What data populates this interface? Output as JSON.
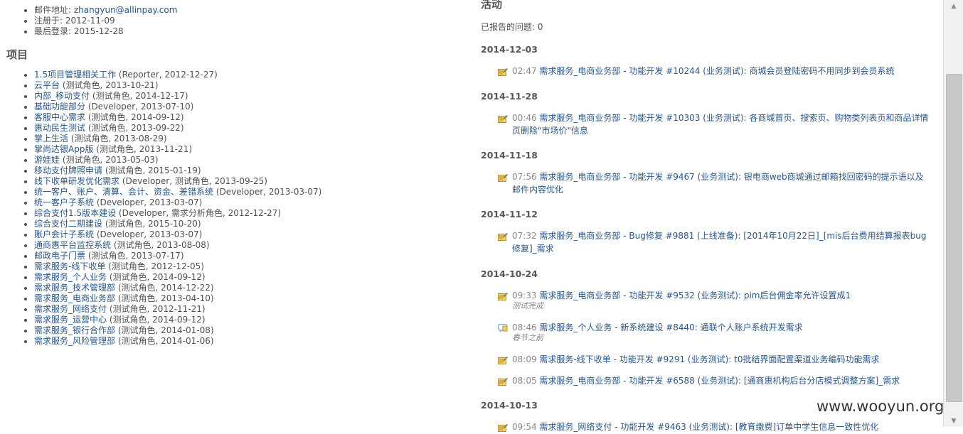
{
  "user_info": {
    "email_label": "邮件地址:",
    "email": "zhangyun@allinpay.com",
    "registered_label": "注册于:",
    "registered": "2012-11-09",
    "last_login_label": "最后登录:",
    "last_login": "2015-12-28"
  },
  "projects": {
    "title": "项目",
    "items": [
      {
        "name": "1.5项目管理相关工作",
        "meta": "(Reporter, 2012-12-27)"
      },
      {
        "name": "云平台",
        "meta": "(测试角色, 2013-10-21)"
      },
      {
        "name": "内部_移动支付",
        "meta": "(测试角色, 2014-12-17)"
      },
      {
        "name": "基础功能部分",
        "meta": "(Developer, 2013-07-10)"
      },
      {
        "name": "客服中心需求",
        "meta": "(测试角色, 2014-09-12)"
      },
      {
        "name": "惠动民生测试",
        "meta": "(测试角色, 2013-09-22)"
      },
      {
        "name": "掌上生活",
        "meta": "(测试角色, 2013-08-29)"
      },
      {
        "name": "掌尚达银App版",
        "meta": "(测试角色, 2013-11-21)"
      },
      {
        "name": "游娃娃",
        "meta": "(测试角色, 2013-05-03)"
      },
      {
        "name": "移动支付牌照申请",
        "meta": "(测试角色, 2015-01-19)"
      },
      {
        "name": "线下收单研发优化需求",
        "meta": "(Developer, 测试角色, 2013-09-25)"
      },
      {
        "name": "统一客户、账户、清算、会计、资金、差错系统",
        "meta": "(Developer, 2013-03-07)"
      },
      {
        "name": "统一客户子系统",
        "meta": "(Developer, 2013-03-07)"
      },
      {
        "name": "综合支付1.5版本建设",
        "meta": "(Developer, 需求分析角色, 2012-12-27)"
      },
      {
        "name": "综合支付二期建设",
        "meta": "(测试角色, 2015-10-20)"
      },
      {
        "name": "账户会计子系统",
        "meta": "(Developer, 2013-03-07)"
      },
      {
        "name": "通商惠平台监控系统",
        "meta": "(测试角色, 2013-08-08)"
      },
      {
        "name": "邮政电子门票",
        "meta": "(测试角色, 2013-07-17)"
      },
      {
        "name": "需求服务-线下收单",
        "meta": "(测试角色, 2012-12-05)"
      },
      {
        "name": "需求服务_个人业务",
        "meta": "(测试角色, 2014-09-12)"
      },
      {
        "name": "需求服务_技术管理部",
        "meta": "(测试角色, 2014-12-22)"
      },
      {
        "name": "需求服务_电商业务部",
        "meta": "(测试角色, 2013-04-10)"
      },
      {
        "name": "需求服务_网络支付",
        "meta": "(测试角色, 2012-11-21)"
      },
      {
        "name": "需求服务_运营中心",
        "meta": "(测试角色, 2014-09-12)"
      },
      {
        "name": "需求服务_银行合作部",
        "meta": "(测试角色, 2014-01-08)"
      },
      {
        "name": "需求服务_风险管理部",
        "meta": "(测试角色, 2014-01-06)"
      }
    ]
  },
  "activity": {
    "title": "活动",
    "reported_issues": "已报告的问题: 0",
    "days": [
      {
        "date": "2014-12-03",
        "events": [
          {
            "time": "02:47",
            "icon": "edit-note-icon",
            "lines": [
              "需求服务_电商业务部 - 功能开发 #10244 (业务测试): 商城会员登陆密码不用同步到会员系统"
            ],
            "desc": ""
          }
        ]
      },
      {
        "date": "2014-11-28",
        "events": [
          {
            "time": "00:46",
            "icon": "edit-note-icon",
            "lines": [
              "需求服务_电商业务部 - 功能开发 #10303 (业务测试): 各商城首页、搜索页、购物类列表页和商品详情",
              "页删除\"市场价\"信息"
            ],
            "desc": ""
          }
        ]
      },
      {
        "date": "2014-11-18",
        "events": [
          {
            "time": "07:56",
            "icon": "edit-note-icon",
            "lines": [
              "需求服务_电商业务部 - 功能开发 #9467 (业务测试): 银电商web商城通过邮箱找回密码的提示语以及",
              "邮件内容优化"
            ],
            "desc": ""
          }
        ]
      },
      {
        "date": "2014-11-12",
        "events": [
          {
            "time": "07:32",
            "icon": "edit-note-icon",
            "lines": [
              "需求服务_电商业务部 - Bug修复 #9881 (上线准备): [2014年10月22日]_[mis后台费用结算报表bug",
              "修复]_需求"
            ],
            "desc": ""
          }
        ]
      },
      {
        "date": "2014-10-24",
        "events": [
          {
            "time": "09:33",
            "icon": "edit-note-icon",
            "lines": [
              "需求服务_电商业务部 - 功能开发 #9532 (业务测试): pim后台佣金率允许设置成1"
            ],
            "desc": "测试完成"
          },
          {
            "time": "08:46",
            "icon": "comment-icon",
            "lines": [
              "需求服务_个人业务 - 新系统建设 #8440: 通联个人账户系统开发需求"
            ],
            "desc": "春节之前"
          },
          {
            "time": "08:09",
            "icon": "edit-note-icon",
            "lines": [
              "需求服务-线下收单 - 功能开发 #9291 (业务测试): t0批结界面配置渠道业务编码功能需求"
            ],
            "desc": ""
          },
          {
            "time": "08:05",
            "icon": "edit-note-icon",
            "lines": [
              "需求服务_电商业务部 - 功能开发 #6588 (业务测试): [通商惠机构后台分店模式调整方案]_需求"
            ],
            "desc": ""
          }
        ]
      },
      {
        "date": "2014-10-13",
        "events": [
          {
            "time": "09:54",
            "icon": "edit-note-icon",
            "lines": [
              "需求服务_网络支付 - 功能开发 #9463 (业务测试): [教育缴费]订单中学生信息一致性优化"
            ],
            "desc": ""
          }
        ]
      }
    ]
  },
  "watermark": "www.wooyun.org"
}
